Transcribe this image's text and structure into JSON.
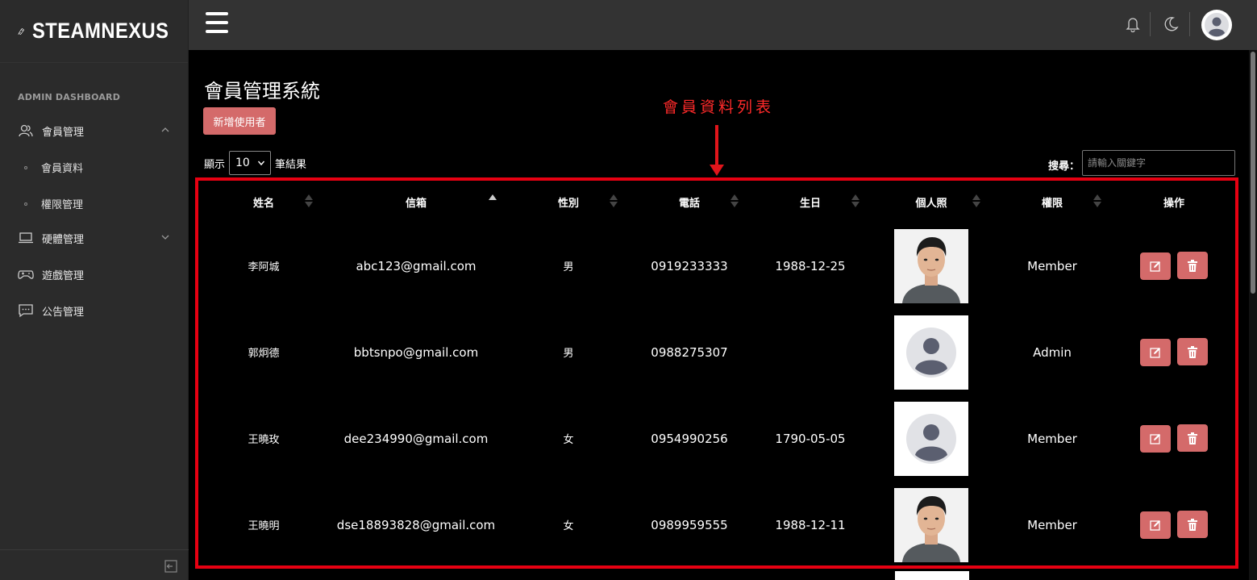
{
  "brand": {
    "name": "STEAMNEXUS"
  },
  "sidebar": {
    "section_title": "ADMIN DASHBOARD",
    "items": [
      {
        "label": "會員管理",
        "icon": "users-icon",
        "expanded": true
      },
      {
        "label": "硬體管理",
        "icon": "laptop-icon",
        "expanded": false
      },
      {
        "label": "遊戲管理",
        "icon": "gamepad-icon"
      },
      {
        "label": "公告管理",
        "icon": "message-icon"
      }
    ],
    "sub_items": [
      {
        "label": "會員資料"
      },
      {
        "label": "權限管理"
      }
    ]
  },
  "page": {
    "title": "會員管理系統",
    "add_button": "新增使用者",
    "annotation": "會員資料列表"
  },
  "table_controls": {
    "show_prefix": "顯示",
    "page_size": "10",
    "show_suffix": "筆結果",
    "search_label": "搜尋：",
    "search_placeholder": "請輸入關鍵字"
  },
  "table": {
    "columns": [
      "姓名",
      "信箱",
      "性別",
      "電話",
      "生日",
      "個人照",
      "權限",
      "操作"
    ],
    "rows": [
      {
        "name": "李阿城",
        "email": "abc123@gmail.com",
        "gender": "男",
        "phone": "0919233333",
        "birthday": "1988-12-25",
        "photo": "portrait",
        "role": "Member"
      },
      {
        "name": "郭炯德",
        "email": "bbtsnpo@gmail.com",
        "gender": "男",
        "phone": "0988275307",
        "birthday": "",
        "photo": "default-avatar",
        "role": "Admin"
      },
      {
        "name": "王曉玫",
        "email": "dee234990@gmail.com",
        "gender": "女",
        "phone": "0954990256",
        "birthday": "1790-05-05",
        "photo": "default-avatar",
        "role": "Member"
      },
      {
        "name": "王曉明",
        "email": "dse18893828@gmail.com",
        "gender": "女",
        "phone": "0989959555",
        "birthday": "1988-12-11",
        "photo": "portrait",
        "role": "Member"
      }
    ]
  },
  "colors": {
    "accent": "#d46a6a",
    "highlight_frame": "#e60012",
    "topbar": "#333333",
    "sidebar": "#2b2b2b"
  }
}
